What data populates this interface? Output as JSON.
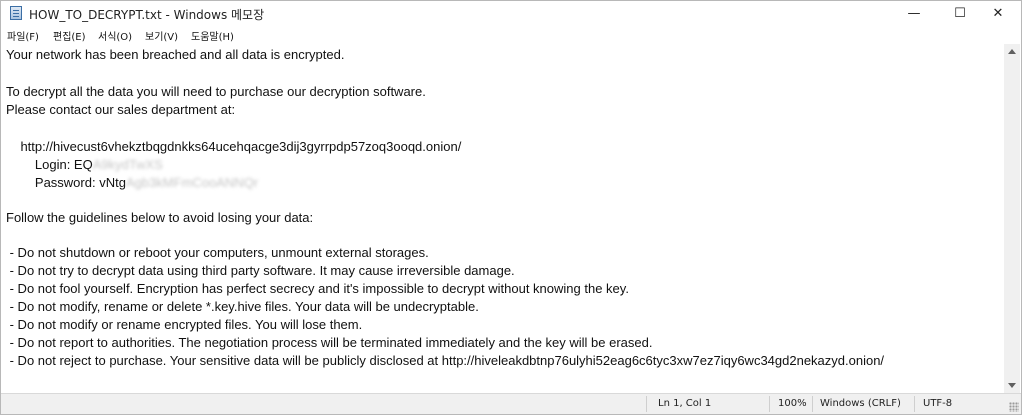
{
  "window": {
    "title": "HOW_TO_DECRYPT.txt - Windows 메모장",
    "buttons": {
      "minimize": "—",
      "maximize": "☐",
      "close": "✕"
    }
  },
  "menu": [
    "파일(F)",
    "편집(E)",
    "서식(O)",
    "보기(V)",
    "도움말(H)"
  ],
  "editor": {
    "lines": [
      "Your network has been breached and all data is encrypted.",
      "",
      "To decrypt all the data you will need to purchase our decryption software.",
      "Please contact our sales department at:",
      "",
      "    http://hivecust6vhekztbqgdnkks64ucehqacge3dij3gyrrpdp57zoq3ooqd.onion/",
      "",
      "",
      "",
      "Follow the guidelines below to avoid losing your data:",
      "",
      " - Do not shutdown or reboot your computers, unmount external storages.",
      " - Do not try to decrypt data using third party software. It may cause irreversible damage.",
      " - Do not fool yourself. Encryption has perfect secrecy and it's impossible to decrypt without knowing the key.",
      " - Do not modify, rename or delete *.key.hive files. Your data will be undecryptable.",
      " - Do not modify or rename encrypted files. You will lose them.",
      " - Do not report to authorities. The negotiation process will be terminated immediately and the key will be erased.",
      " - Do not reject to purchase. Your sensitive data will be publicly disclosed at http://hiveleakdbtnp76ulyhi52eag6c6tyc3xw7ez7iqy6wc34gd2nekazyd.onion/"
    ],
    "login_label": "        Login: EQ",
    "login_blurred": "A9kydTwXS",
    "password_label": "        Password: vNtg",
    "password_blurred": "Agb3kMFmCooANNQr"
  },
  "status": {
    "position": "Ln 1, Col 1",
    "zoom": "100%",
    "line_ending": "Windows (CRLF)",
    "encoding": "UTF-8"
  }
}
